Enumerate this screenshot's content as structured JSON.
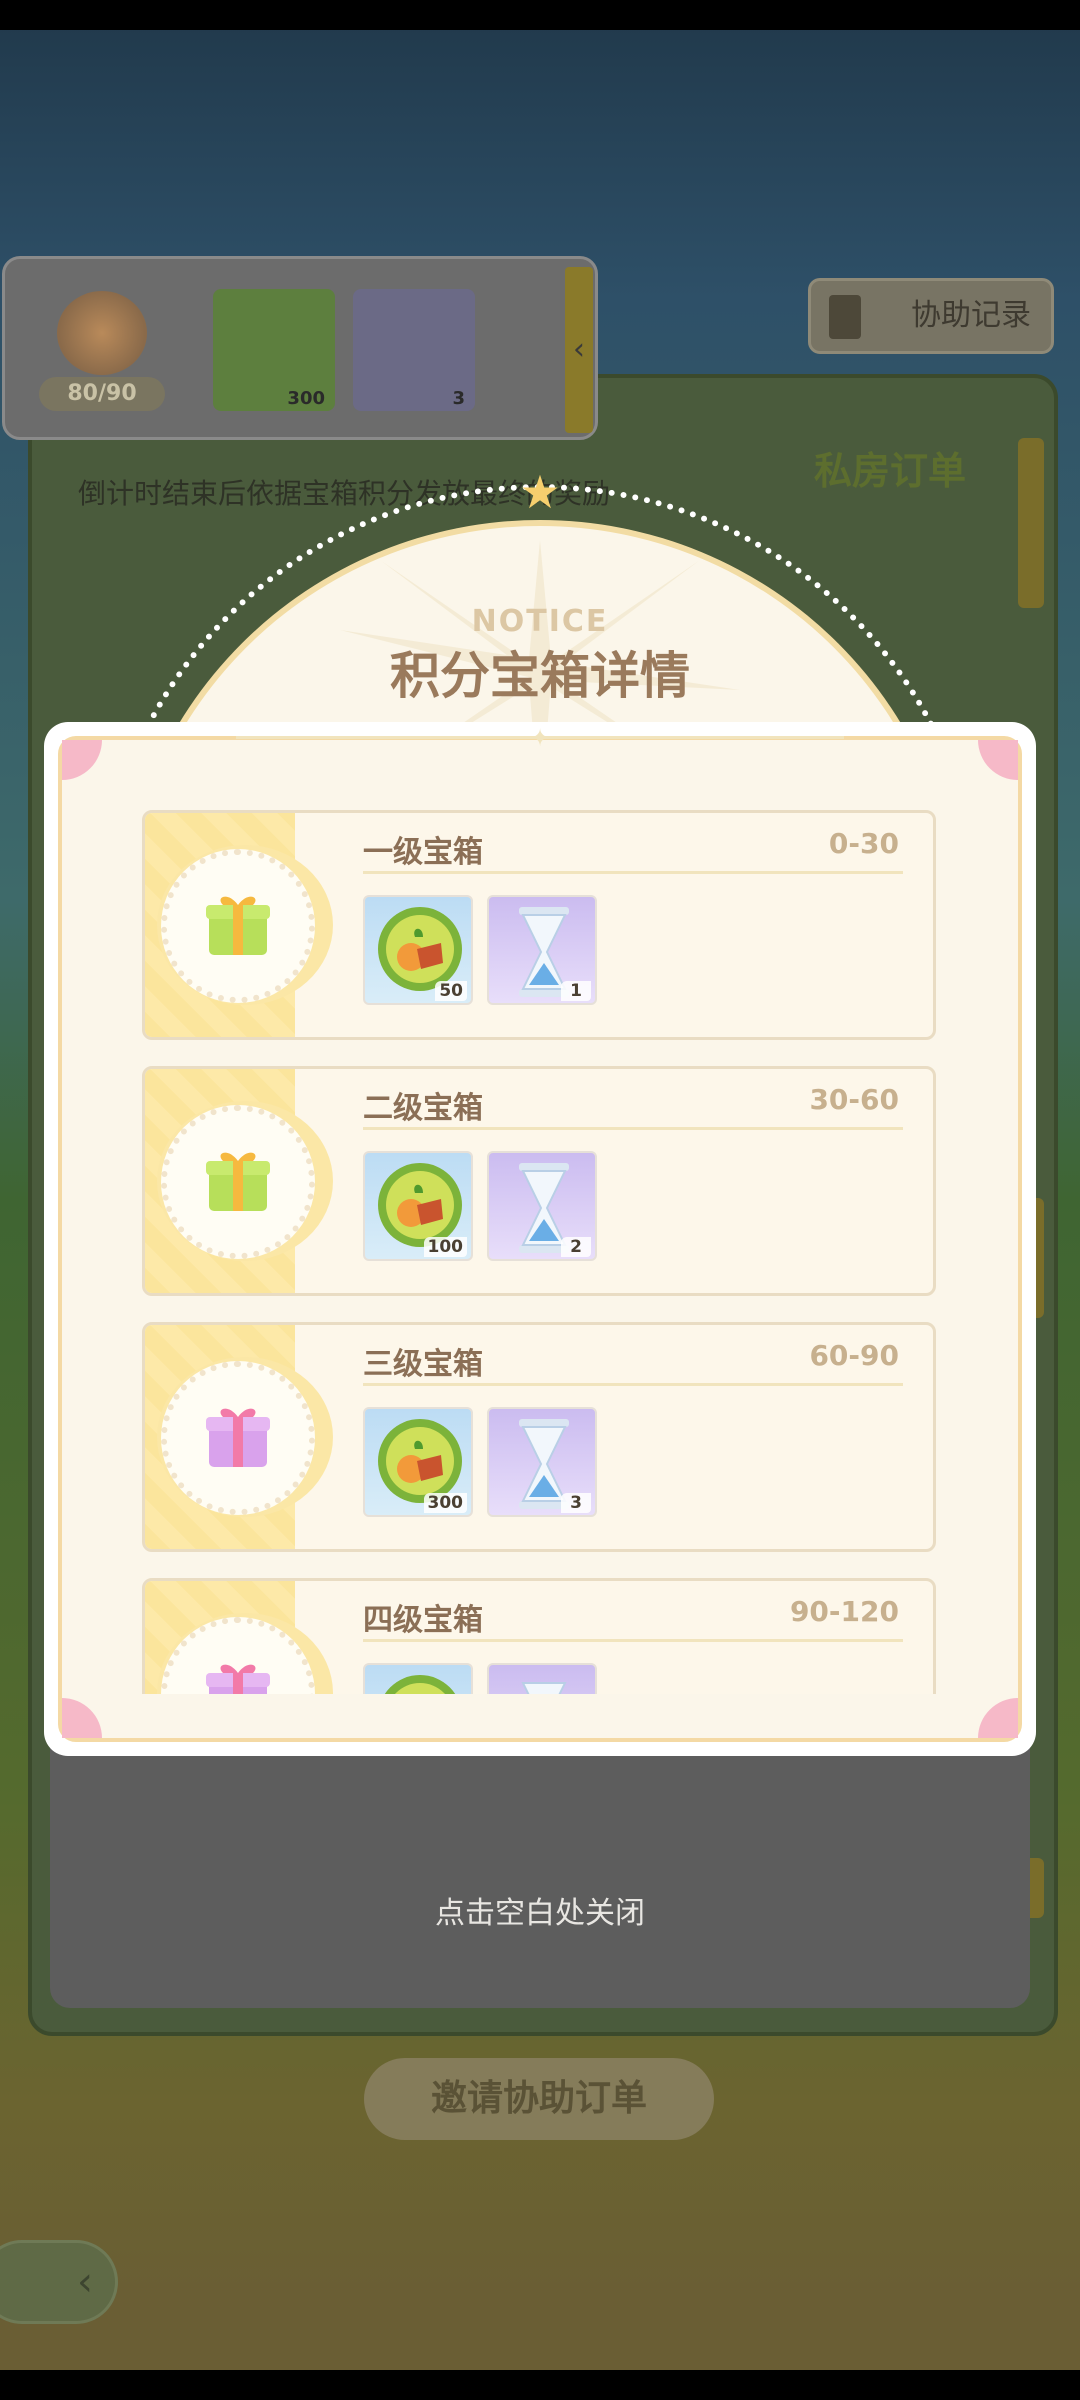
{
  "background": {
    "score": "80/90",
    "reward_items": [
      {
        "kind": "coin-icon",
        "qty": "300"
      },
      {
        "kind": "hourglass-icon",
        "qty": "3"
      }
    ],
    "record_button": "协助记录",
    "order_label": "私房订单",
    "notice_line": "倒计时结束后依据宝箱积分发放最终的奖励",
    "invite_button": "邀请协助订单"
  },
  "modal": {
    "notice": "NOTICE",
    "title": "积分宝箱详情",
    "boxes": [
      {
        "name": "一级宝箱",
        "range": "0-30",
        "gift_color": "green",
        "coin": "50",
        "hourglass": "1"
      },
      {
        "name": "二级宝箱",
        "range": "30-60",
        "gift_color": "green",
        "coin": "100",
        "hourglass": "2"
      },
      {
        "name": "三级宝箱",
        "range": "60-90",
        "gift_color": "pink",
        "coin": "300",
        "hourglass": "3"
      },
      {
        "name": "四级宝箱",
        "range": "90-120",
        "gift_color": "pink",
        "coin": "",
        "hourglass": ""
      }
    ],
    "close_hint": "点击空白处关闭"
  },
  "colors": {
    "modal_bg": "#fbf6ea",
    "title": "#9a7a5c",
    "range": "#c7b08e",
    "gift_green": "#b7df5a",
    "gift_pink": "#e6a0e0"
  }
}
